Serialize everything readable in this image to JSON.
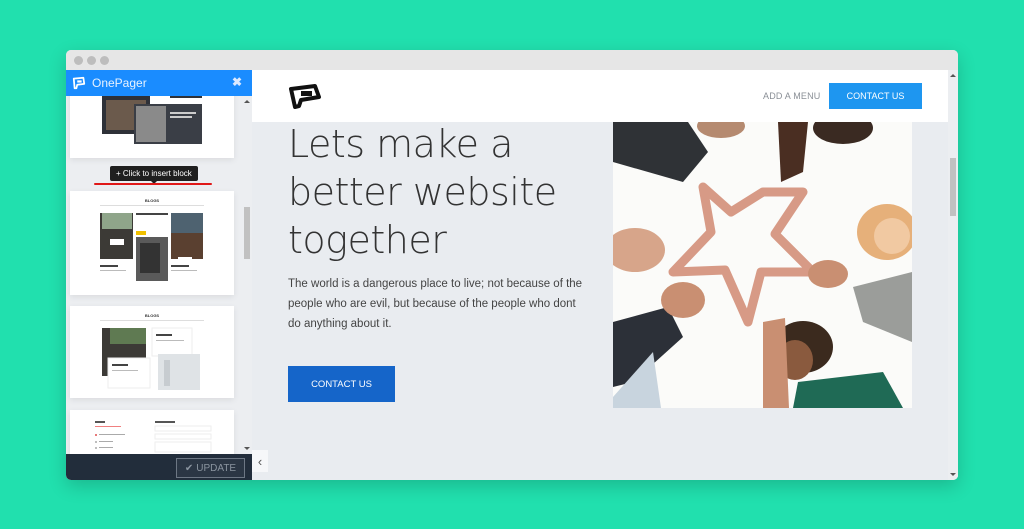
{
  "window": {
    "controls": [
      "close",
      "minimize",
      "maximize"
    ]
  },
  "sidebar": {
    "title": "OnePager",
    "close_icon": "✖",
    "tooltip": "+ Click to insert block",
    "thumbnails": [
      {
        "name": "dark-cards-block"
      },
      {
        "name": "three-column-cards-block",
        "heading": "BLOGS"
      },
      {
        "name": "two-column-cards-block",
        "heading": "BLOGS"
      },
      {
        "name": "contact-form-block"
      }
    ],
    "update_label": "UPDATE",
    "update_icon": "✔"
  },
  "site": {
    "nav": {
      "menu_label": "ADD A MENU",
      "contact_label": "CONTACT US"
    },
    "hero": {
      "title": "Lets make a better website together",
      "text": "The world is a dangerous place to live; not because of the people who are evil, but because of the people who dont do anything about it.",
      "button_label": "CONTACT US",
      "image_alt": "Group of people forming a star with their hands"
    },
    "collapse_icon": "‹"
  },
  "colors": {
    "background": "#21e0ae",
    "sidebar_header": "#1a8cff",
    "sidebar_footer": "#222d3b",
    "nav_button": "#1e96f0",
    "hero_button": "#1565c9",
    "insert_line": "#e01818"
  }
}
